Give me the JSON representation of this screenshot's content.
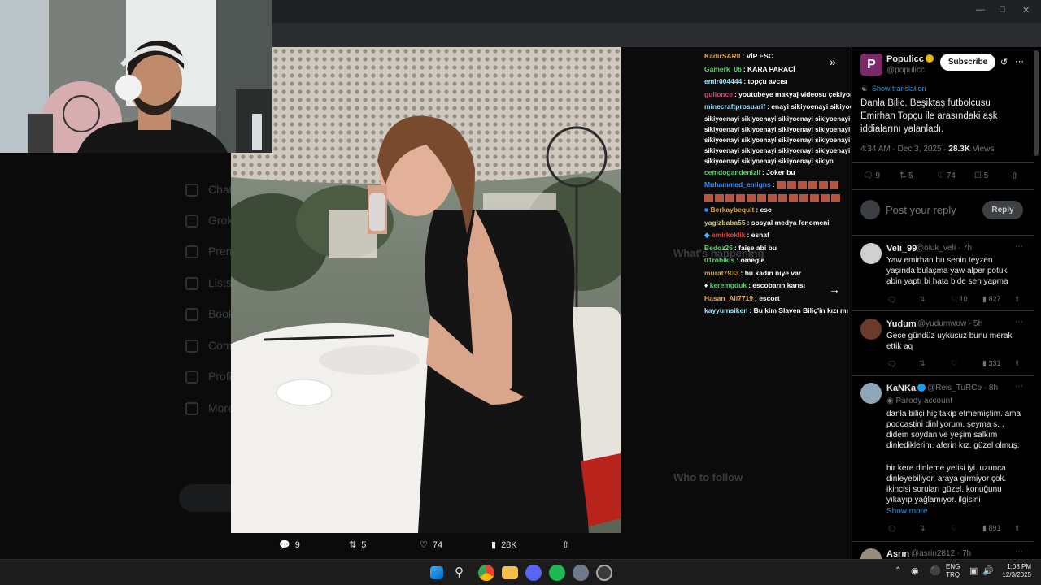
{
  "image_actions": {
    "replies": "9",
    "reposts": "5",
    "likes": "74",
    "views": "28K"
  },
  "chat": {
    "messages": [
      {
        "user": "KadirSARII",
        "color": "#e0a64b",
        "text": ": VİP ESC"
      },
      {
        "user": "Gamerk_06",
        "color": "#59d36b",
        "text": ": KARA PARACİ"
      },
      {
        "user": "emir004444",
        "color": "#9be8ff",
        "text": ": topçu avcısı"
      },
      {
        "user": "gulionce",
        "color": "#e0447a",
        "text": ": youtubeye makyaj videosu çekiyordu"
      },
      {
        "user": "minecraftprosuarif",
        "color": "#8fe0ff",
        "text": ": enayi sikiyoenayi sikiyoenayi"
      },
      {
        "user": "cemdogandenizli",
        "color": "#59d36b",
        "text": ": Joker bu"
      },
      {
        "user": "Muhammed_emigns",
        "color": "#3f8cff",
        "text": ":"
      },
      {
        "user": "Berkaybequit",
        "color": "#e0a64b",
        "text": ": esc"
      },
      {
        "user": "yagizbaba55",
        "color": "#c9c96b",
        "text": ": sosyal medya fenomeni"
      },
      {
        "user": "emirkeklik",
        "color": "#e04444",
        "text": ": esnaf"
      },
      {
        "user": "Bedoz26",
        "color": "#59d36b",
        "text": ": faişe abi bu"
      },
      {
        "user": "01robikis",
        "color": "#59d36b",
        "text": ": omegle"
      },
      {
        "user": "murat7933",
        "color": "#d3a84b",
        "text": ": bu kadın niye var"
      },
      {
        "user": "keremgduk",
        "color": "#59d36b",
        "text": ": escobarın karısı"
      },
      {
        "user": "Hasan_Ali7719",
        "color": "#e0a64b",
        "text": ": escort"
      },
      {
        "user": "kayyumsiken",
        "color": "#9be8ff",
        "text": ": Bu kim Slaven Biliç'in kızı mı"
      }
    ],
    "spam": [
      "sikiyoenayi sikiyoenayi sikiyoenayi sikiyoenayi",
      "sikiyoenayi sikiyoenayi sikiyoenayi sikiyoenayi",
      "sikiyoenayi sikiyoenayi sikiyoenayi sikiyoenayi",
      "sikiyoenayi sikiyoenayi sikiyoenayi sikiyoenayi",
      "sikiyoenayi sikiyoenayi sikiyoenayi sikiyo"
    ]
  },
  "tweet": {
    "author_name": "Populicc",
    "author_handle": "@populicc",
    "subscribe": "Subscribe",
    "show_translation": "Show translation",
    "text": "Danla Bilic, Beşiktaş futbolcusu Emirhan Topçu ile arasındaki aşk iddialarını yalanladı.",
    "time": "4:34 AM · Dec 3, 2025 ·",
    "views_count": "28.3K",
    "views_label": "Views",
    "stats": {
      "replies": "9",
      "reposts": "5",
      "likes": "74",
      "bookmarks": "5"
    },
    "reply_placeholder": "Post your reply",
    "reply_button": "Reply"
  },
  "replies": [
    {
      "name": "Veli_99",
      "handle": "@oluk_veli · 7h",
      "text": "Yaw emirhan bu senin teyzen yaşında bulaşma yaw alper potuk abin yaptı bi hata bide sen yapma",
      "likes": "10",
      "views": "827"
    },
    {
      "name": "Yudum",
      "handle": "@yudumwow · 5h",
      "text": "Gece gündüz uykusuz bunu merak ettik aq",
      "likes": "",
      "views": "331"
    },
    {
      "name": "KaNKa",
      "handle": "@Reis_TuRCo · 8h",
      "badge": "Parody account",
      "text1": "danla biliçi hiç takip etmemiştim. ama podcastini dinliyorum. şeyma s. , didem soydan ve yeşim salkım dinlediklerim. aferin kız. güzel olmuş.",
      "text2": "bir kere dinleme yetisi iyi. uzunca dinleyebiliyor, araya girmiyor çok. ikincisi soruları güzel. konuğunu yıkayıp yağlamıyor. ilgisini",
      "show_more": "Show more",
      "views": "891"
    },
    {
      "name": "Asrın",
      "handle": "@asrin2812 · 7h"
    }
  ],
  "bg": {
    "nav": [
      "Chat",
      "Grok",
      "Premium",
      "Lists",
      "Bookmarks",
      "Communities",
      "Profile",
      "More"
    ],
    "right": [
      "What's happening",
      "Who to follow"
    ]
  },
  "taskbar": {
    "lang1": "ENG",
    "lang2": "TRQ",
    "time": "1:08 PM",
    "date": "12/3/2025"
  },
  "colors": {
    "accent": "#1d9bf0",
    "panel_bg": "#000000",
    "chrome": "#202124"
  }
}
